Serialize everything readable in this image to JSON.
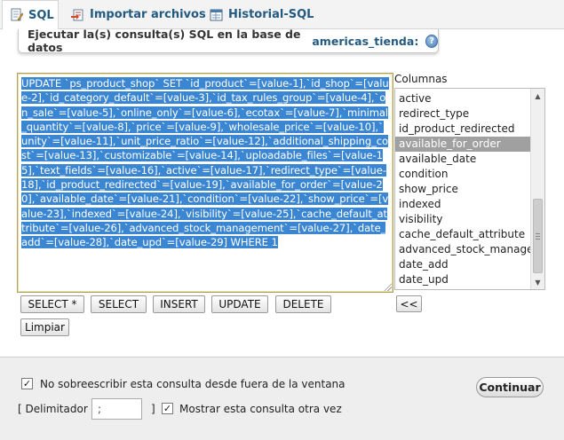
{
  "tabs": [
    {
      "label": "SQL",
      "icon": "document-edit-icon",
      "active": true
    },
    {
      "label": "Importar archivos",
      "icon": "import-icon",
      "active": false
    },
    {
      "label": "Historial-SQL",
      "icon": "history-icon",
      "active": false
    }
  ],
  "header": {
    "prefix": "Ejecutar la(s) consulta(s) SQL en la base de datos",
    "database": "americas_tienda:",
    "help_symbol": "?"
  },
  "sql": {
    "text": "UPDATE `ps_product_shop` SET `id_product`=[value-1],`id_shop`=[value-2],`id_category_default`=[value-3],`id_tax_rules_group`=[value-4],`on_sale`=[value-5],`online_only`=[value-6],`ecotax`=[value-7],`minimal_quantity`=[value-8],`price`=[value-9],`wholesale_price`=[value-10],`unity`=[value-11],`unit_price_ratio`=[value-12],`additional_shipping_cost`=[value-13],`customizable`=[value-14],`uploadable_files`=[value-15],`text_fields`=[value-16],`active`=[value-17],`redirect_type`=[value-18],`id_product_redirected`=[value-19],`available_for_order`=[value-20],`available_date`=[value-21],`condition`=[value-22],`show_price`=[value-23],`indexed`=[value-24],`visibility`=[value-25],`cache_default_attribute`=[value-26],`advanced_stock_management`=[value-27],`date_add`=[value-28],`date_upd`=[value-29] WHERE 1",
    "selection_color": "#3b86d2"
  },
  "columns": {
    "label": "Columnas",
    "items": [
      "active",
      "redirect_type",
      "id_product_redirected",
      "available_for_order",
      "available_date",
      "condition",
      "show_price",
      "indexed",
      "visibility",
      "cache_default_attribute",
      "advanced_stock_manage",
      "date_add",
      "date_upd"
    ],
    "selected": "available_for_order",
    "insert_label": "<<"
  },
  "buttons": {
    "select_all": "SELECT *",
    "select": "SELECT",
    "insert": "INSERT",
    "update": "UPDATE",
    "delete": "DELETE",
    "clear": "Limpiar"
  },
  "options": {
    "no_overwrite_label": "No sobreescribir esta consulta desde fuera de la ventana",
    "no_overwrite_checked": true,
    "delimiter_open": "[ Delimitador",
    "delimiter_value": ";",
    "delimiter_close": "]",
    "show_again_label": "Mostrar esta consulta otra vez",
    "show_again_checked": true,
    "check_mark": "✓",
    "continue": "Continuar"
  }
}
